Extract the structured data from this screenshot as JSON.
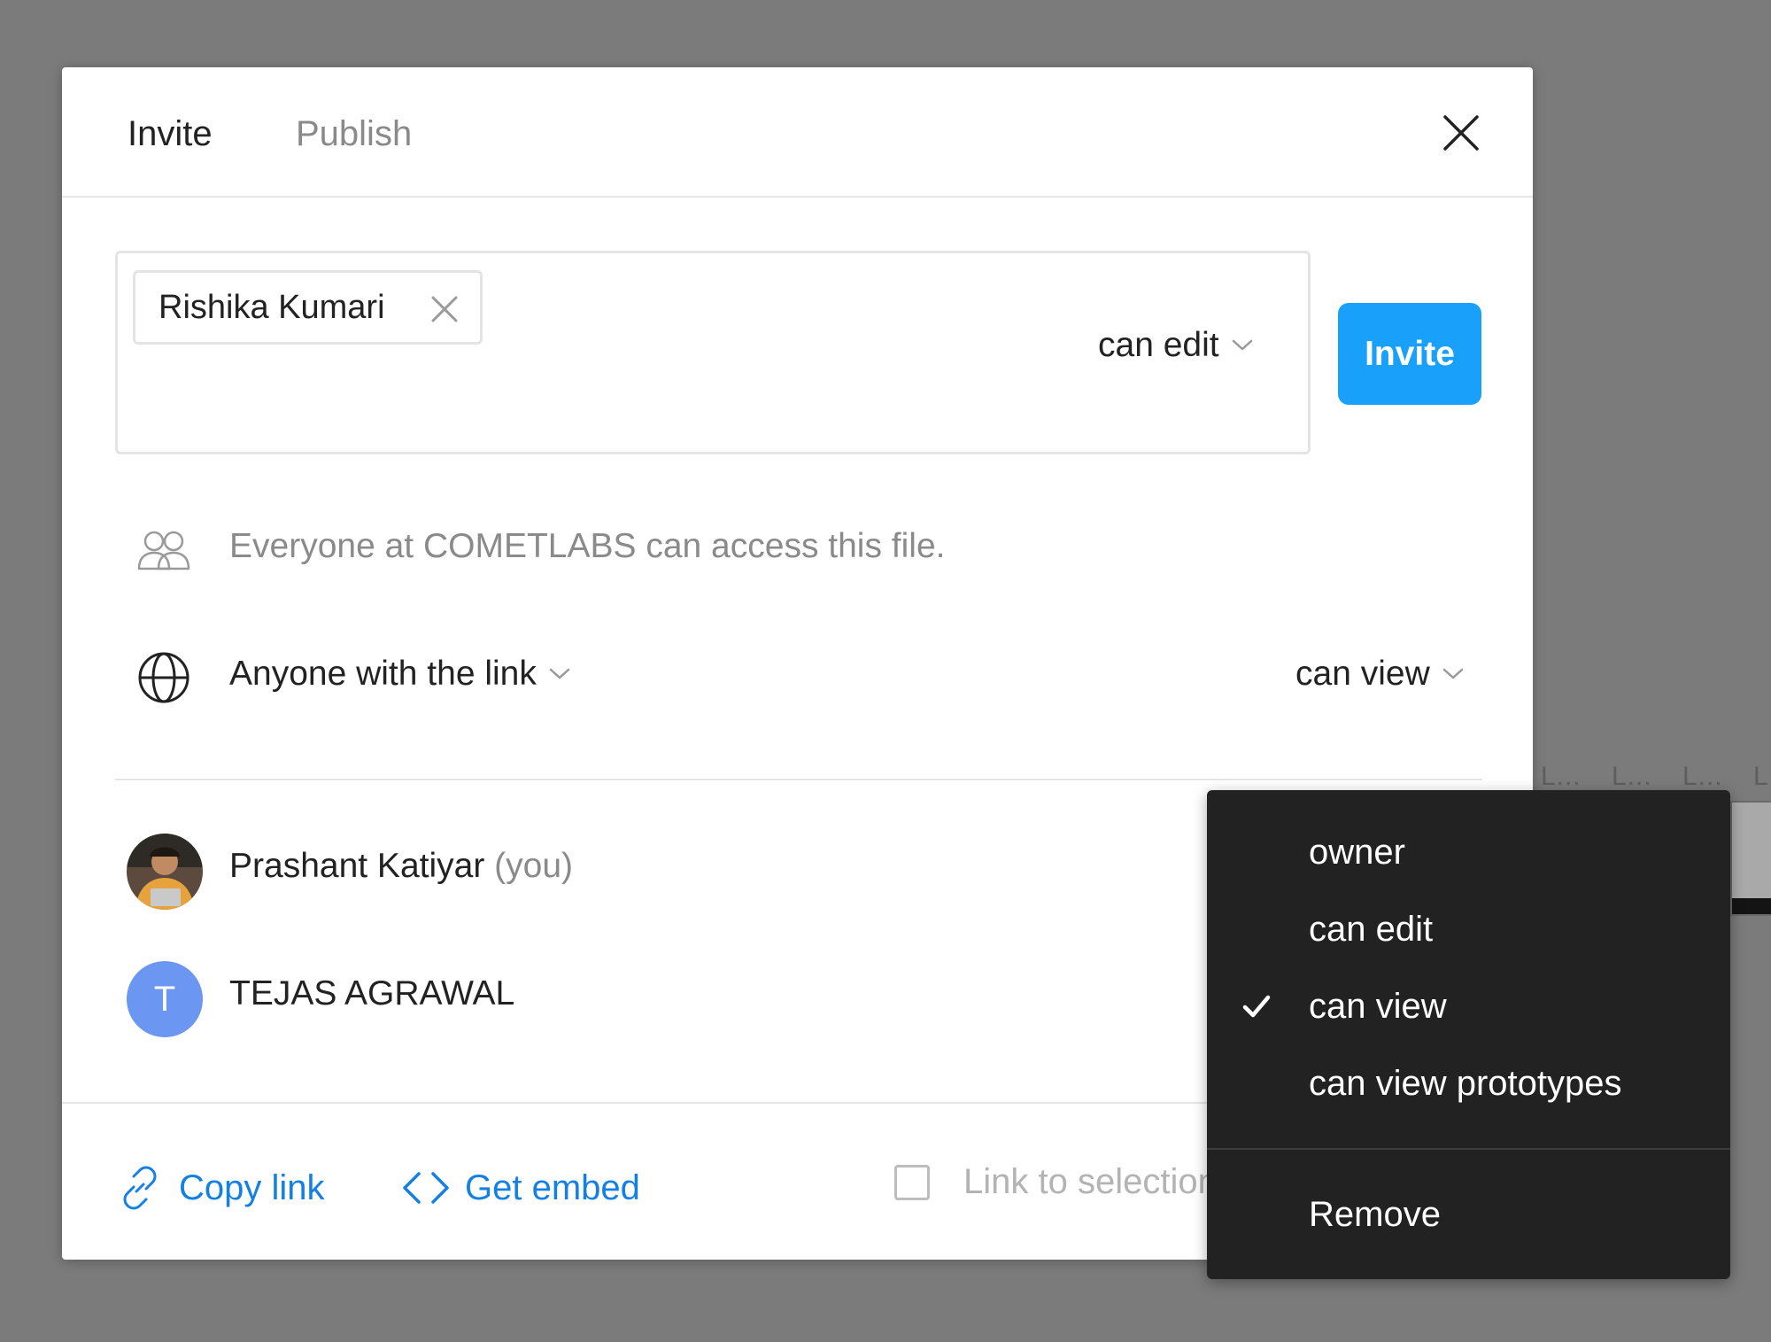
{
  "background": {
    "frame_labels": [
      "L...",
      "L...",
      "L...",
      "L"
    ]
  },
  "tabs": [
    {
      "label": "Invite",
      "active": true
    },
    {
      "label": "Publish",
      "active": false
    }
  ],
  "invite": {
    "chip_name": "Rishika Kumari",
    "permission": "can edit",
    "button_label": "Invite"
  },
  "access": {
    "org_notice": "Everyone at COMETLABS can access this file.",
    "link_scope": "Anyone with the link",
    "link_permission": "can view"
  },
  "people": [
    {
      "name": "Prashant Katiyar",
      "suffix": "(you)"
    },
    {
      "name": "TEJAS AGRAWAL",
      "initial": "T"
    }
  ],
  "footer": {
    "copy_link": "Copy link",
    "get_embed": "Get embed",
    "link_to_selection": "Link to selection"
  },
  "menu": {
    "items": [
      {
        "label": "owner",
        "checked": false
      },
      {
        "label": "can edit",
        "checked": false
      },
      {
        "label": "can view",
        "checked": true
      },
      {
        "label": "can view prototypes",
        "checked": false
      }
    ],
    "remove_label": "Remove"
  },
  "colors": {
    "accent": "#18a0fb",
    "link": "#1480e3",
    "avatar_t": "#6b96f1",
    "menu_bg": "#222222",
    "overlay": "#7b7b7b"
  }
}
